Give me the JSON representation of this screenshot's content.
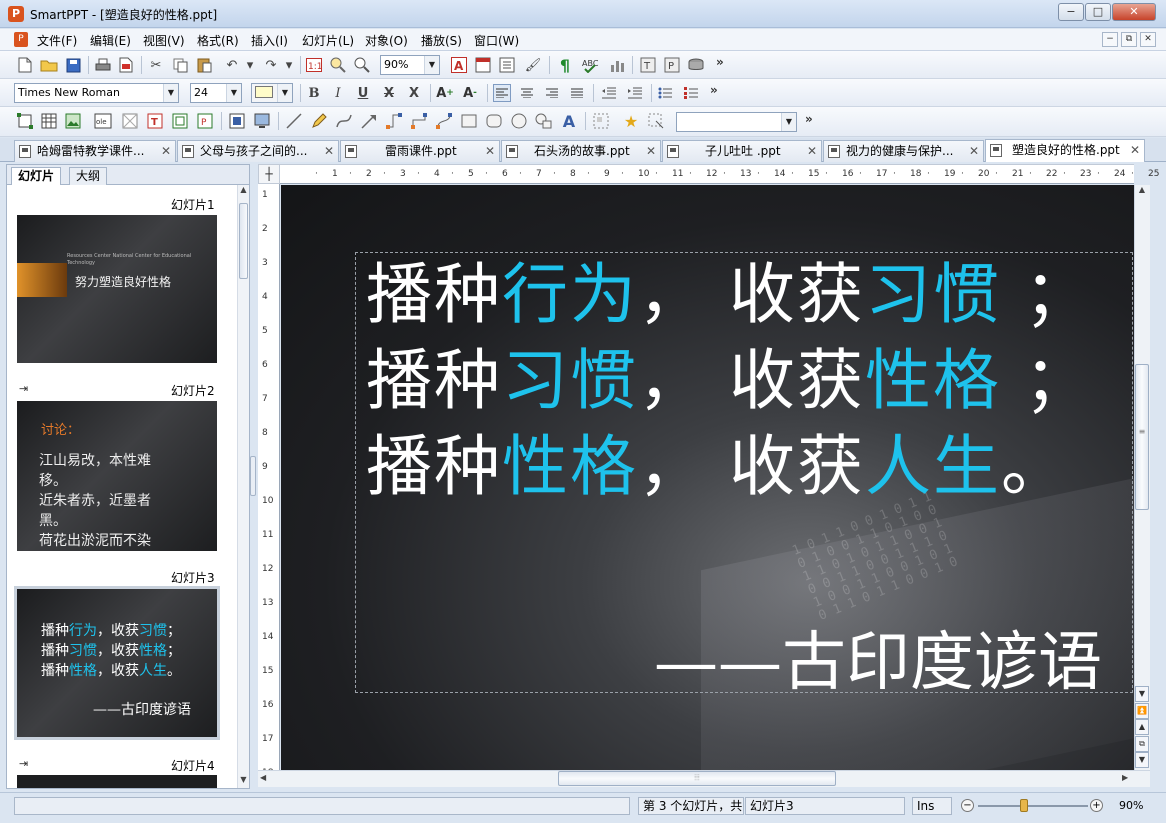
{
  "window": {
    "title": "SmartPPT - [塑造良好的性格.ppt]",
    "icon_letter": "P",
    "minimize": "−",
    "maximize": "□",
    "close": "✕"
  },
  "menu": [
    "文件(F)",
    "编辑(E)",
    "视图(V)",
    "格式(R)",
    "插入(I)",
    "幻灯片(L)",
    "对象(O)",
    "播放(S)",
    "窗口(W)"
  ],
  "mdi_buttons": [
    "−",
    "⧉",
    "✕"
  ],
  "toolbar1": {
    "zoom_value": "90%",
    "more": "»"
  },
  "toolbar2": {
    "font_name": "Times New Roman",
    "font_size": "24",
    "more": "»"
  },
  "toolbar3": {
    "style_value": "",
    "more": "»"
  },
  "doc_tabs": [
    {
      "label": "哈姆雷特教学课件...",
      "active": false
    },
    {
      "label": "父母与孩子之间的...",
      "active": false
    },
    {
      "label": "雷雨课件.ppt",
      "active": false
    },
    {
      "label": "石头汤的故事.ppt",
      "active": false
    },
    {
      "label": "子儿吐吐 .ppt",
      "active": false
    },
    {
      "label": "视力的健康与保护...",
      "active": false
    },
    {
      "label": "塑造良好的性格.ppt",
      "active": true
    }
  ],
  "tab_close": "✕",
  "panel_tabs": {
    "slides": "幻灯片",
    "outline": "大纲"
  },
  "slides": [
    {
      "label": "幻灯片1",
      "title_text": "努力塑造良好性格",
      "small_text_1": "Resources Center National Center for Educational Technology"
    },
    {
      "label": "幻灯片2",
      "heading": "讨论：",
      "lines": [
        "江山易改，本性难",
        "移。",
        "近朱者赤，近墨者",
        "黑。",
        "荷花出淤泥而不染"
      ]
    },
    {
      "label": "幻灯片3",
      "lines": [
        [
          {
            "t": "播种",
            "c": false
          },
          {
            "t": "行为",
            "c": true
          },
          {
            "t": "，收获",
            "c": false
          },
          {
            "t": "习惯",
            "c": true
          },
          {
            "t": "；",
            "c": false
          }
        ],
        [
          {
            "t": "播种",
            "c": false
          },
          {
            "t": "习惯",
            "c": true
          },
          {
            "t": "，收获",
            "c": false
          },
          {
            "t": "性格",
            "c": true
          },
          {
            "t": "；",
            "c": false
          }
        ],
        [
          {
            "t": "播种",
            "c": false
          },
          {
            "t": "性格",
            "c": true
          },
          {
            "t": "，收获",
            "c": false
          },
          {
            "t": "人生",
            "c": true
          },
          {
            "t": "。",
            "c": false
          }
        ]
      ],
      "attribution": "——古印度谚语"
    },
    {
      "label": "幻灯片4"
    }
  ],
  "hruler_ticks": [
    "1",
    "2",
    "3",
    "4",
    "5",
    "6",
    "7",
    "8",
    "9",
    "10",
    "11",
    "12",
    "13",
    "14",
    "15",
    "16",
    "17",
    "18",
    "19",
    "20",
    "21",
    "22",
    "23",
    "24",
    "25"
  ],
  "vruler_ticks": [
    "1",
    "2",
    "3",
    "4",
    "5",
    "6",
    "7",
    "8",
    "9",
    "10",
    "11",
    "12",
    "13",
    "14",
    "15",
    "16",
    "17",
    "18"
  ],
  "main_slide": {
    "lines": [
      [
        {
          "t": "播种",
          "c": false
        },
        {
          "t": "行为",
          "c": true
        },
        {
          "t": "，  收获",
          "c": false
        },
        {
          "t": "习惯",
          "c": true
        },
        {
          "t": " ；",
          "c": false
        }
      ],
      [
        {
          "t": "播种",
          "c": false
        },
        {
          "t": "习惯",
          "c": true
        },
        {
          "t": "，  收获",
          "c": false
        },
        {
          "t": "性格",
          "c": true
        },
        {
          "t": " ；",
          "c": false
        }
      ],
      [
        {
          "t": "播种",
          "c": false
        },
        {
          "t": "性格",
          "c": true
        },
        {
          "t": "，  收获",
          "c": false
        },
        {
          "t": "人生",
          "c": true
        },
        {
          "t": "。",
          "c": false
        }
      ]
    ],
    "attribution": "——古印度谚语",
    "highlight_color": "#1ec2ec"
  },
  "status": {
    "slide_info": "第 3 个幻灯片，共",
    "slide_name": "幻灯片3",
    "mode": "Ins",
    "zoom": "90%",
    "zoom_fraction": 0.42
  }
}
